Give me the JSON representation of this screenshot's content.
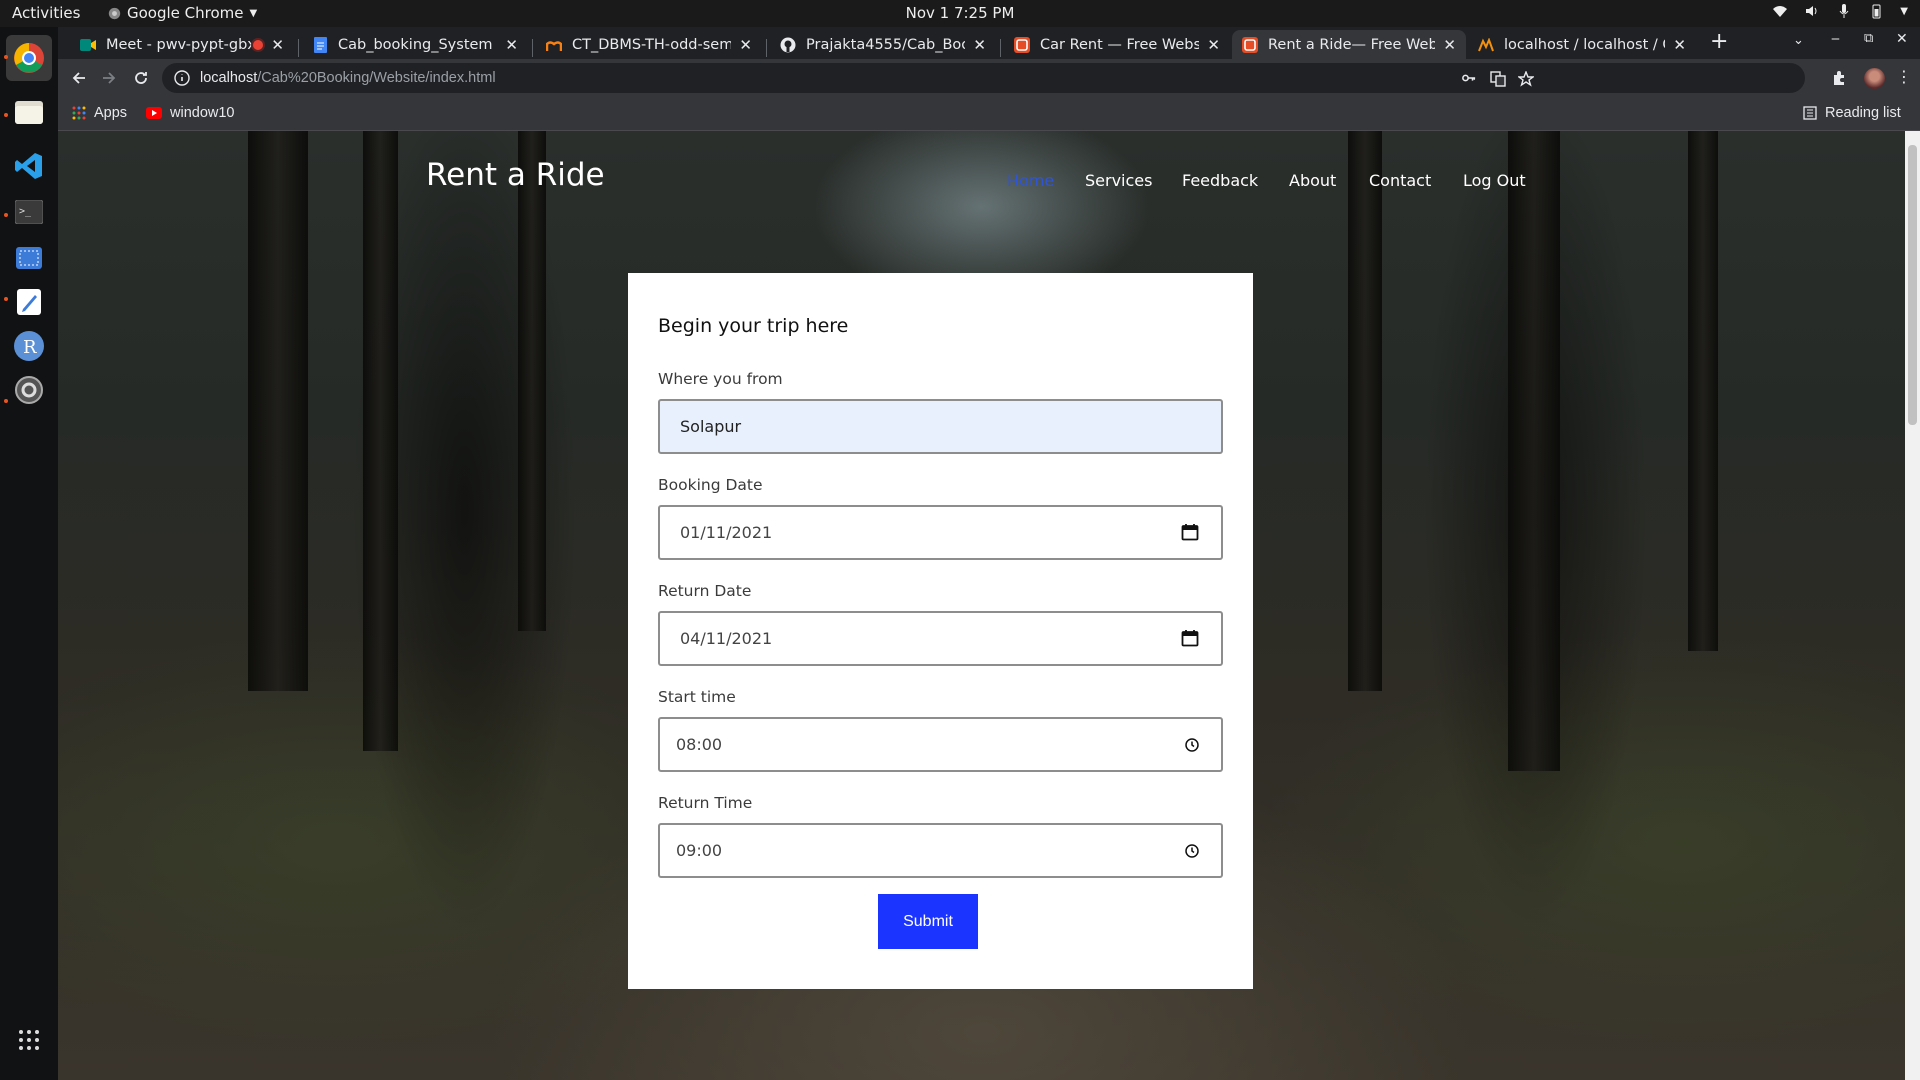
{
  "topbar": {
    "activities": "Activities",
    "app_name": "Google Chrome",
    "clock": "Nov 1  7:25 PM"
  },
  "tabs": [
    {
      "title": "Meet - pwv-pypt-gbx",
      "icon": "google-meet-icon",
      "recording": true
    },
    {
      "title": "Cab_booking_System - G",
      "icon": "google-docs-icon"
    },
    {
      "title": "CT_DBMS-TH-odd-sem-2",
      "icon": "moodle-icon"
    },
    {
      "title": "Prajakta4555/Cab_Booki",
      "icon": "github-icon"
    },
    {
      "title": "Car Rent — Free Website",
      "icon": "html5-icon"
    },
    {
      "title": "Rent a Ride— Free Websi",
      "icon": "html5-icon",
      "active": true
    },
    {
      "title": "localhost / localhost / Ca",
      "icon": "phpmyadmin-icon"
    }
  ],
  "address_bar": {
    "host": "localhost",
    "path": "/Cab%20Booking/Website/index.html"
  },
  "bookmarks": {
    "apps": "Apps",
    "item1": "window10",
    "reading_list": "Reading list"
  },
  "site": {
    "brand": "Rent a Ride",
    "nav": [
      "Home",
      "Services",
      "Feedback",
      "About",
      "Contact",
      "Log Out"
    ]
  },
  "form": {
    "heading": "Begin your trip here",
    "from_label": "Where you from",
    "from_value": "Solapur",
    "booking_date_label": "Booking Date",
    "booking_date_value": "01/11/2021",
    "return_date_label": "Return Date",
    "return_date_value": "04/11/2021",
    "start_time_label": "Start time",
    "start_time_value": "08:00",
    "return_time_label": "Return Time",
    "return_time_value": "09:00",
    "submit_label": "Submit"
  },
  "colors": {
    "accent": "#1c34ff",
    "nav_active": "#2f55d4",
    "autofill_bg": "#e8f0fe"
  }
}
